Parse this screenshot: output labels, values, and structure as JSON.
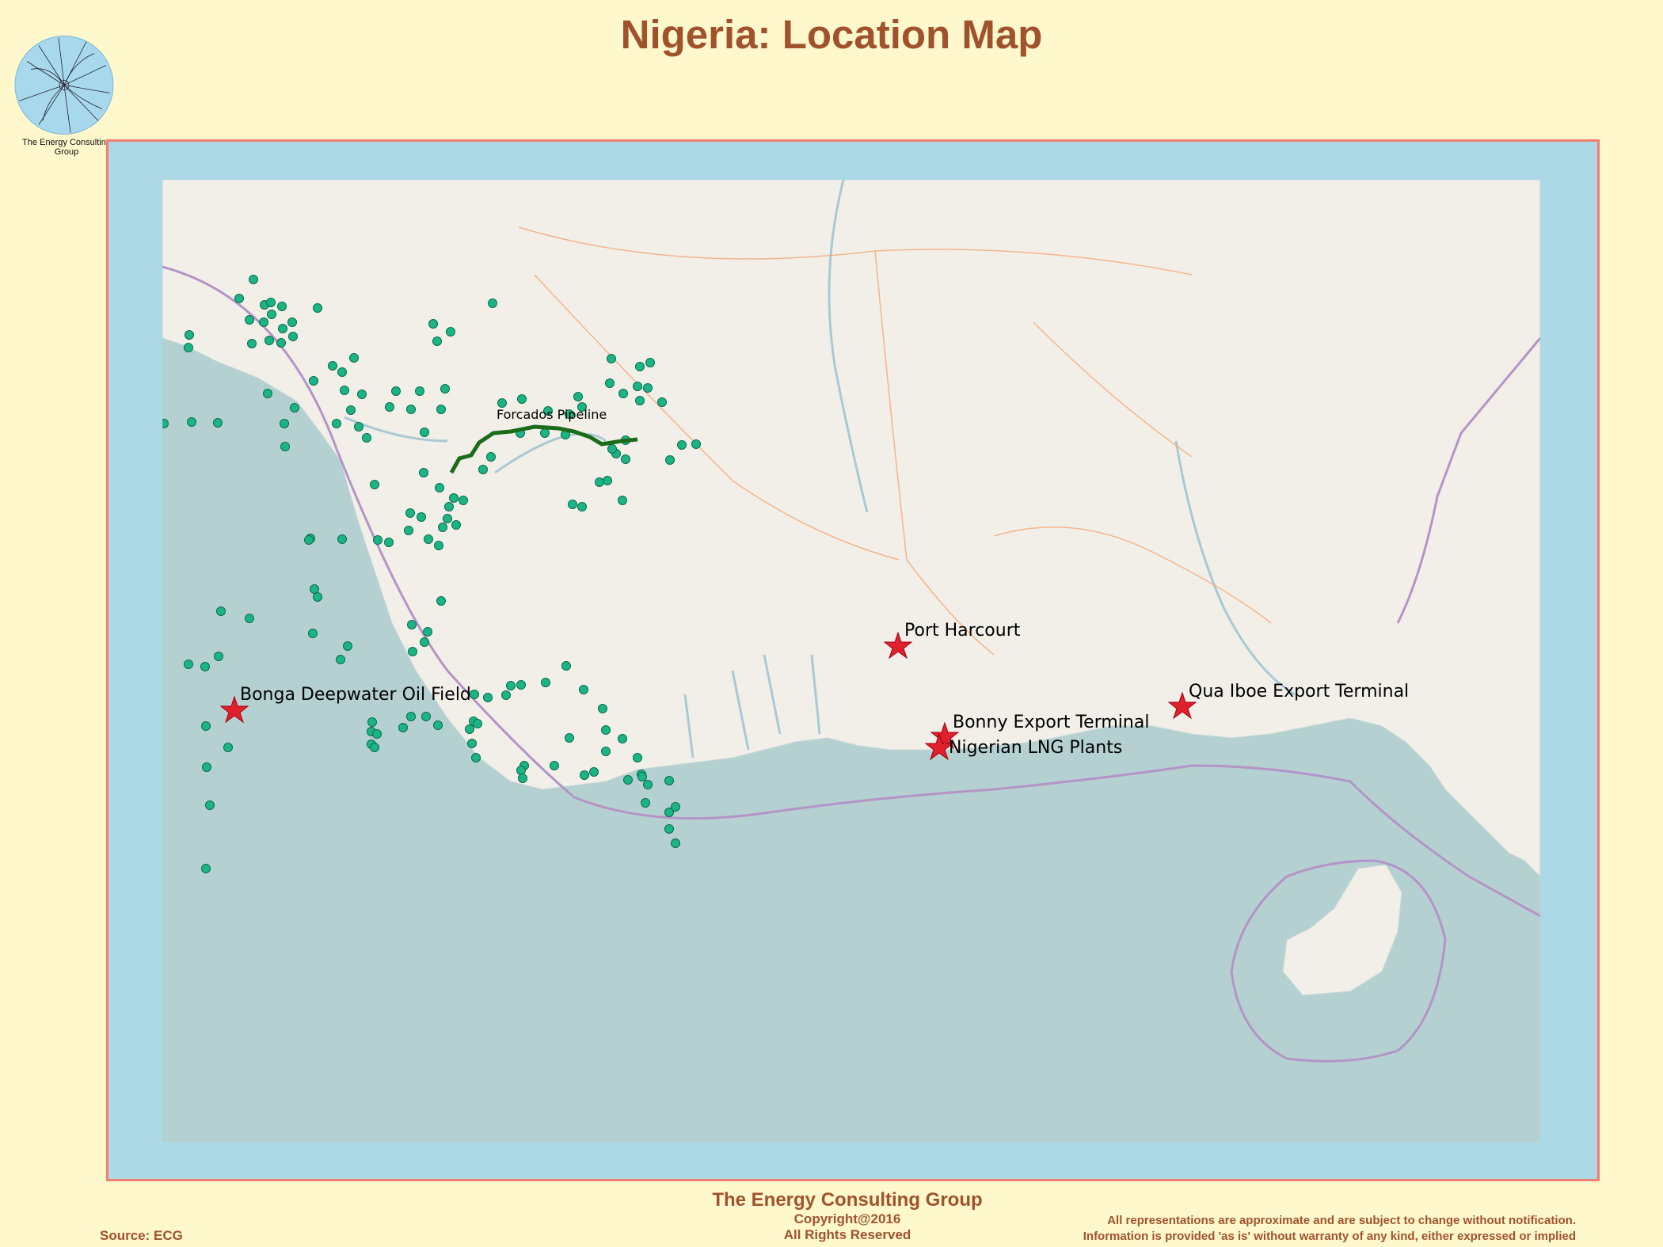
{
  "header": {
    "title": "Nigeria: Location Map"
  },
  "logo": {
    "text": "The Energy Consulting Group"
  },
  "map": {
    "colors": {
      "sea": "#b5d0d0",
      "land": "#f2efe9",
      "frame": "#add8e6",
      "border": "#f08070",
      "wells": "#1bb585",
      "markers": "#e0202a",
      "pipeline": "#1a6b1a",
      "maritime_boundary": "#b394c7"
    },
    "markers": [
      {
        "label": "Port Harcourt",
        "icon": "star-icon"
      },
      {
        "label": "Bonga Deepwater Oil Field",
        "icon": "star-icon"
      },
      {
        "label": "Qua Iboe Export Terminal",
        "icon": "star-icon"
      },
      {
        "label": "Bonny Export Terminal",
        "icon": "star-icon"
      },
      {
        "label": "Nigerian LNG Plants",
        "icon": "star-icon"
      }
    ],
    "pipeline": {
      "label": "Forcados Pipeline"
    },
    "well_icon": "oil-well-dot-icon"
  },
  "footer": {
    "org": "The Energy Consulting Group",
    "copyright": "Copyright@2016",
    "rights": "All Rights Reserved",
    "source": "Source: ECG",
    "disclaimer_line1": "All representations are approximate and are subject to change without notification.",
    "disclaimer_line2": "Information is provided 'as is' without warranty of any kind, either expressed or implied"
  }
}
